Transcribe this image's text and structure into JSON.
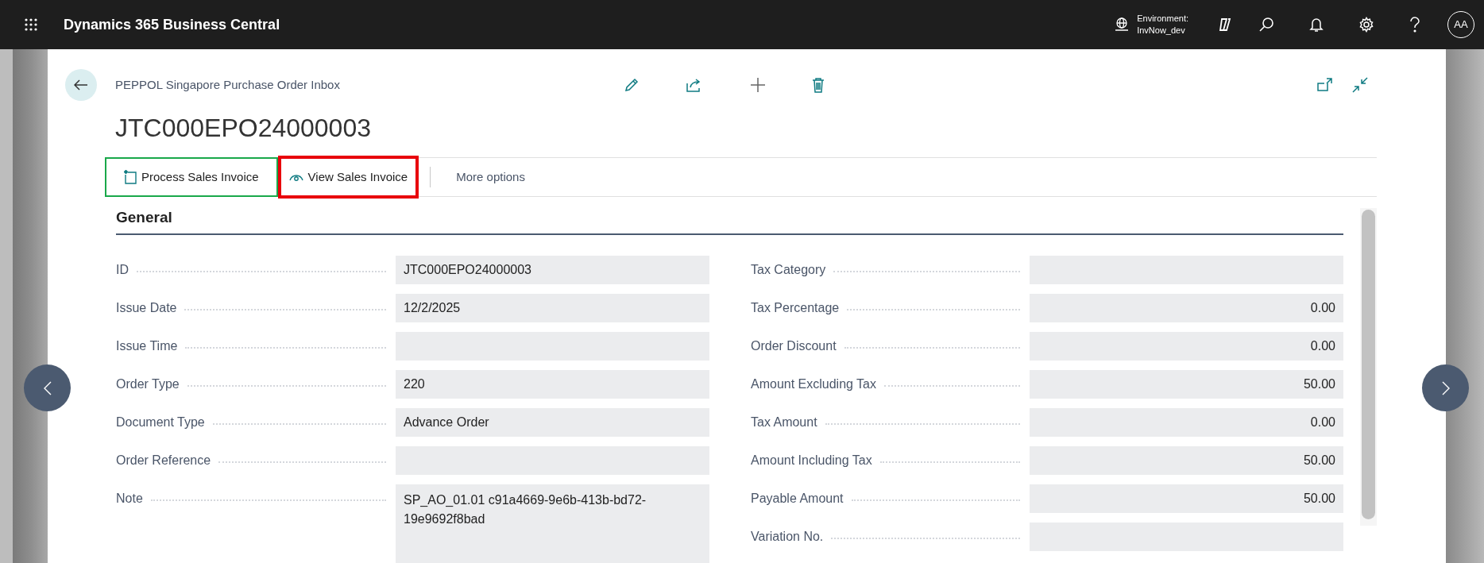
{
  "app_bar": {
    "title": "Dynamics 365 Business Central",
    "environment_label": "Environment:",
    "environment_name": "InvNow_dev",
    "avatar": "AA"
  },
  "page": {
    "breadcrumb": "PEPPOL Singapore Purchase Order Inbox",
    "title": "JTC000EPO24000003"
  },
  "actions": [
    {
      "kind": "process",
      "label": "Process Sales Invoice",
      "color": "#19a84a"
    },
    {
      "kind": "view",
      "label": "View Sales Invoice",
      "color": "#e8000b"
    },
    {
      "kind": "more",
      "label": "More options"
    }
  ],
  "section": {
    "title": "General",
    "left_fields": [
      {
        "kind": "text",
        "label": "ID",
        "value": "JTC000EPO24000003"
      },
      {
        "kind": "text",
        "label": "Issue Date",
        "value": "12/2/2025"
      },
      {
        "kind": "text",
        "label": "Issue Time"
      },
      {
        "kind": "text",
        "label": "Order Type",
        "value": "220"
      },
      {
        "kind": "text",
        "label": "Document Type",
        "value": "Advance Order"
      },
      {
        "kind": "text",
        "label": "Order Reference"
      },
      {
        "kind": "note",
        "label": "Note",
        "value": "SP_AO_01.01 c91a4669-9e6b-413b-bd72-19e9692f8bad"
      }
    ],
    "right_fields": [
      {
        "kind": "text",
        "label": "Tax Category"
      },
      {
        "kind": "number",
        "label": "Tax Percentage",
        "value": "0.00"
      },
      {
        "kind": "number",
        "label": "Order Discount",
        "value": "0.00"
      },
      {
        "kind": "number",
        "label": "Amount Excluding Tax",
        "value": "50.00"
      },
      {
        "kind": "number",
        "label": "Tax Amount",
        "value": "0.00"
      },
      {
        "kind": "number",
        "label": "Amount Including Tax",
        "value": "50.00"
      },
      {
        "kind": "number",
        "label": "Payable Amount",
        "value": "50.00"
      },
      {
        "kind": "text",
        "label": "Variation No."
      }
    ]
  }
}
